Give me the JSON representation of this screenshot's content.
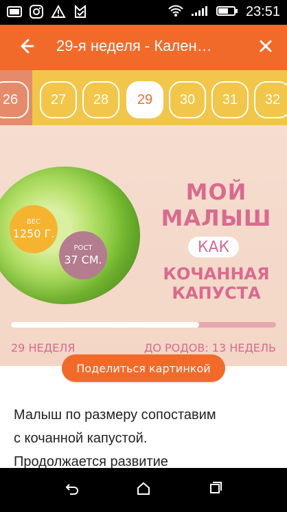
{
  "status_bar": {
    "time": "23:51",
    "icons_left": [
      "gallery-icon",
      "instagram-icon",
      "warning-icon",
      "download-icon"
    ],
    "icons_right": [
      "wifi-icon",
      "signal-icon",
      "battery-icon"
    ]
  },
  "toolbar": {
    "title": "29-я неделя - Кален…",
    "back_icon": "arrow-left-icon",
    "close_icon": "close-icon"
  },
  "weeks": {
    "items": [
      "26",
      "27",
      "28",
      "29",
      "30",
      "31",
      "32"
    ],
    "active": "29"
  },
  "hero": {
    "headline_line1": "МОЙ МАЛЫШ",
    "headline_line2": "КАК",
    "headline_line3": "КОЧАННАЯ КАПУСТА",
    "weight_label": "ВЕС",
    "weight_value": "1250 Г.",
    "height_label": "РОСТ",
    "height_value": "37 СМ.",
    "progress_fraction": 0.71,
    "week_label": "29 НЕДЕЛЯ",
    "due_label": "ДО РОДОВ: 13 НЕДЕЛЬ"
  },
  "share_button": {
    "label": "Поделиться картинкой"
  },
  "content": {
    "text": "Малыш по размеру сопоставим\nс кочанной капустой.\nПродолжается развитие"
  },
  "colors": {
    "toolbar": "#f26a2a",
    "strip": "#f1c64a",
    "accent": "#d86b8f"
  }
}
